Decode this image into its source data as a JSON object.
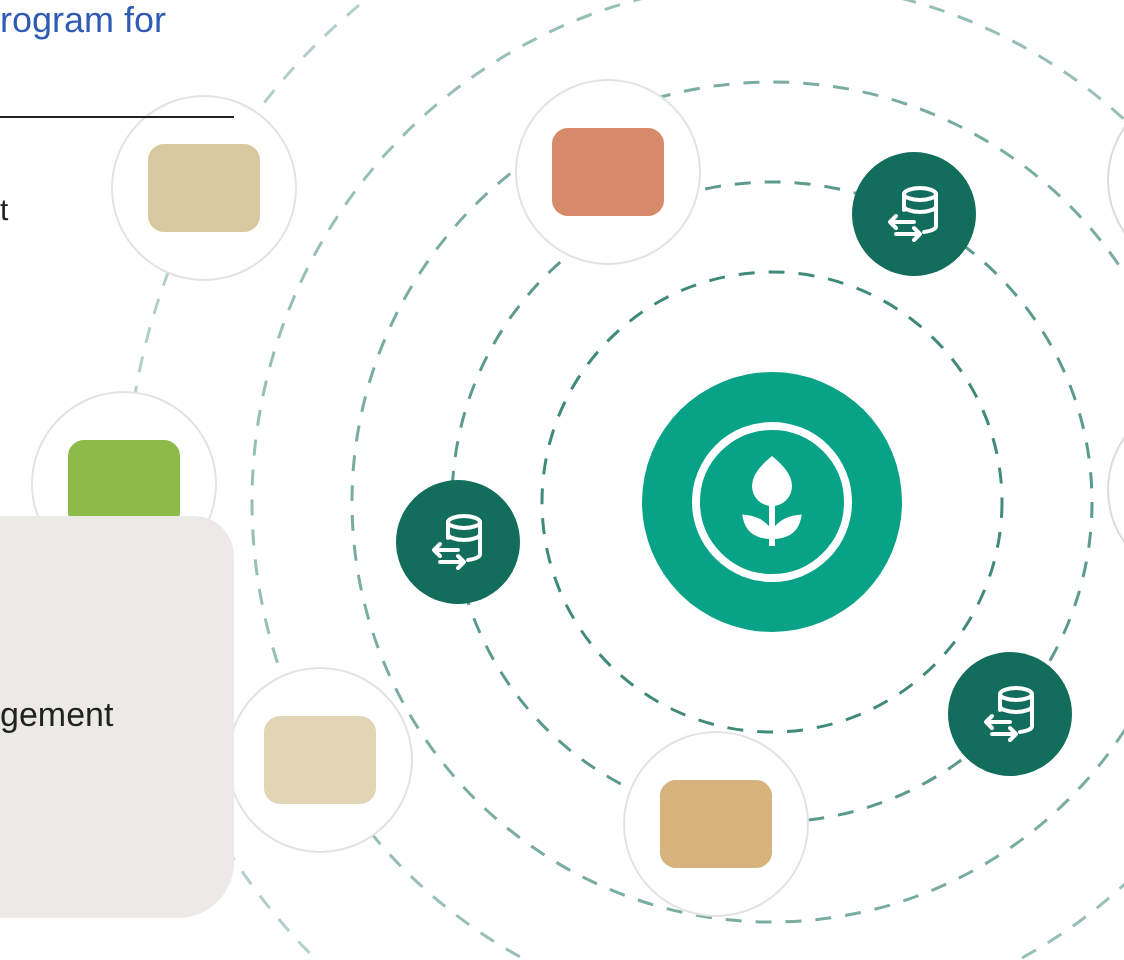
{
  "heading": "rogram for",
  "intro_text": "t",
  "card": {
    "text": "gement"
  }
}
